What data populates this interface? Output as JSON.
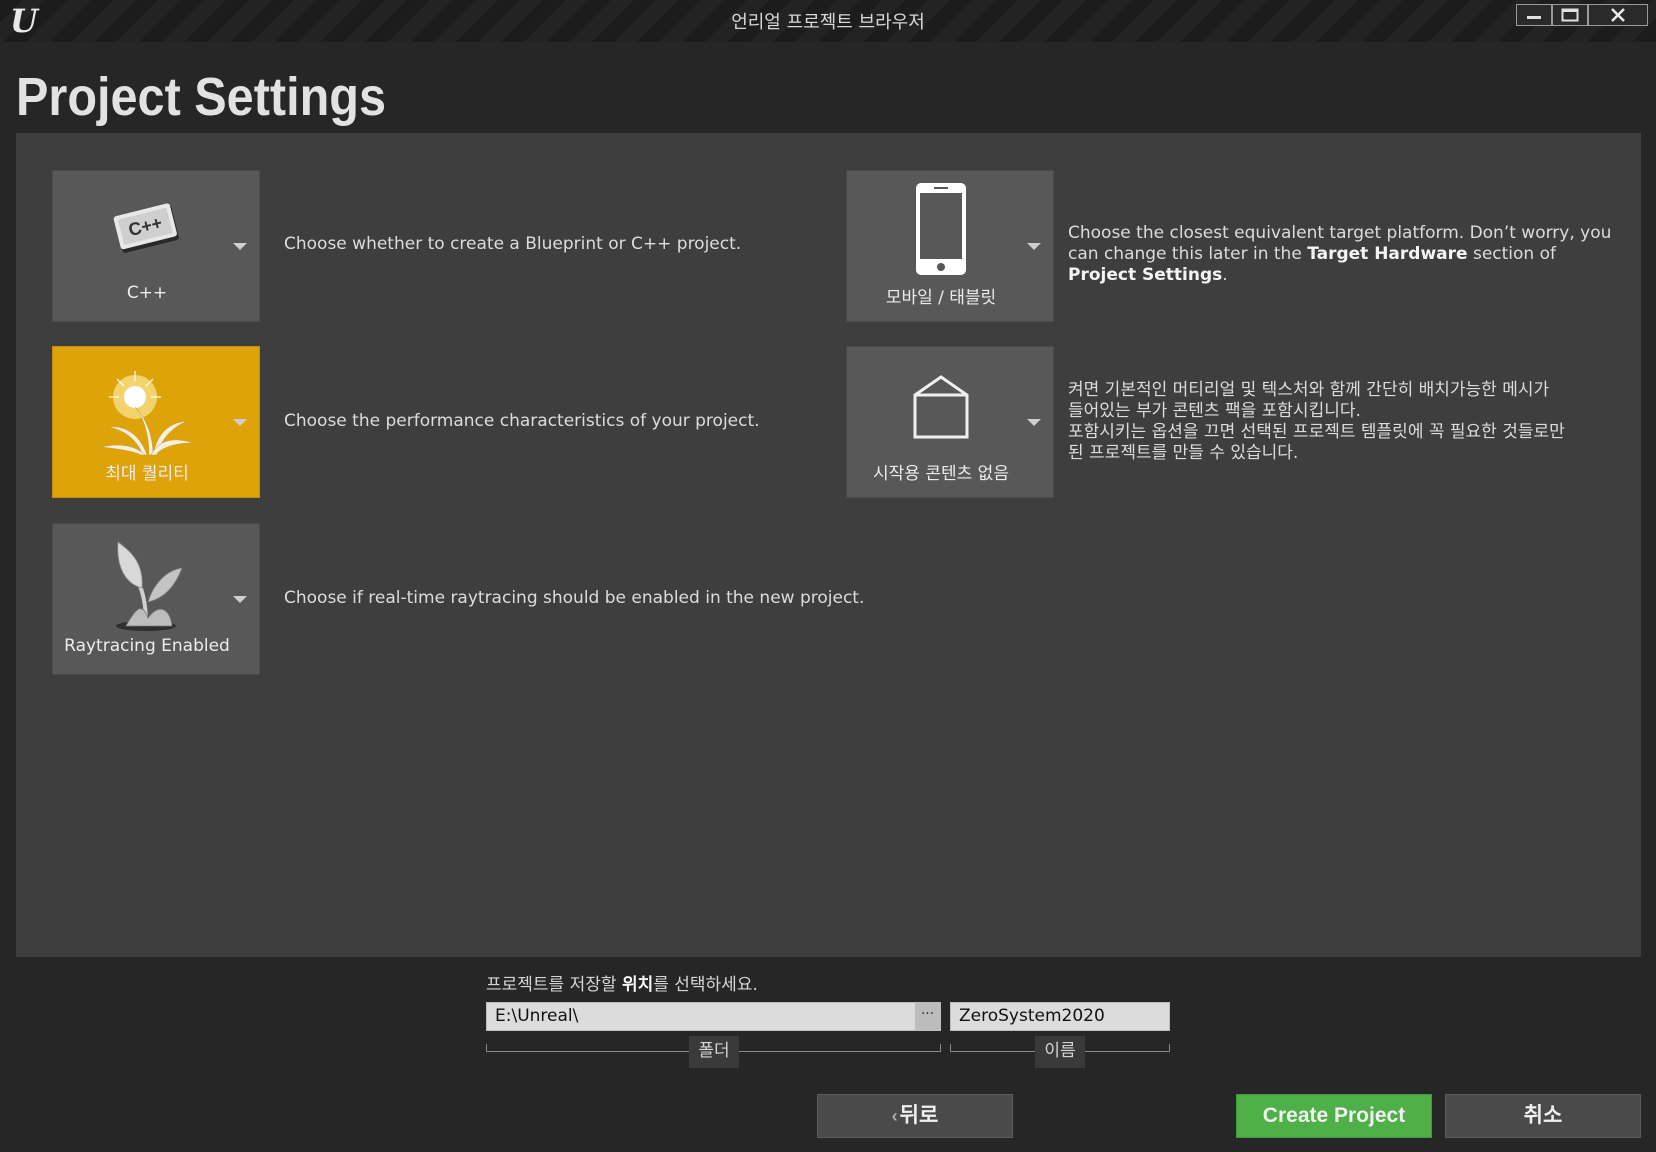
{
  "window": {
    "title": "언리얼 프로젝트 브라우저",
    "logo_icon": "unreal-logo",
    "controls": [
      "minimize",
      "maximize",
      "close"
    ]
  },
  "page": {
    "title": "Project Settings"
  },
  "settings": {
    "project_type": {
      "label": "C++",
      "icon": "cpp-badge-icon",
      "description": "Choose whether to create a Blueprint or C++ project."
    },
    "quality": {
      "label": "최대 퀄리티",
      "icon": "sun-plant-icon",
      "description": "Choose the performance characteristics of your project.",
      "selected": true
    },
    "raytracing": {
      "label": "Raytracing Enabled",
      "icon": "sprout-icon",
      "description": "Choose if real-time raytracing should be enabled in the new project."
    },
    "platform": {
      "label": "모바일 / 태블릿",
      "icon": "phone-icon",
      "description_part1": "Choose the closest equivalent target platform. Don’t worry, you can change this later in the ",
      "description_bold1": "Target Hardware",
      "description_part2": " section of ",
      "description_bold2": "Project Settings",
      "description_part3": "."
    },
    "starter_content": {
      "label": "시작용 콘텐츠 없음",
      "icon": "empty-box-icon",
      "description_line1": "켜면 기본적인 머티리얼 및 텍스처와 함께 간단히 배치가능한 메시가",
      "description_line2": "들어있는 부가 콘텐츠 팩을 포함시킵니다.",
      "description_line3": "포함시키는 옵션을 끄면 선택된 프로젝트 템플릿에 꼭 필요한 것들로만",
      "description_line4": "된 프로젝트를 만들 수 있습니다."
    }
  },
  "location": {
    "prompt_part1": "프로젝트를 저장할 ",
    "prompt_bold": "위치",
    "prompt_part2": "를 선택하세요.",
    "folder_value": "E:\\Unreal\\",
    "browse_label": "···",
    "folder_caption": "폴더",
    "name_value": "ZeroSystem2020",
    "name_caption": "이름"
  },
  "buttons": {
    "back": "뒤로",
    "create": "Create Project",
    "cancel": "취소"
  },
  "colors": {
    "selected_tile": "#dfa30a",
    "create_button": "#4faf48",
    "panel_bg": "#3e3e3e"
  }
}
